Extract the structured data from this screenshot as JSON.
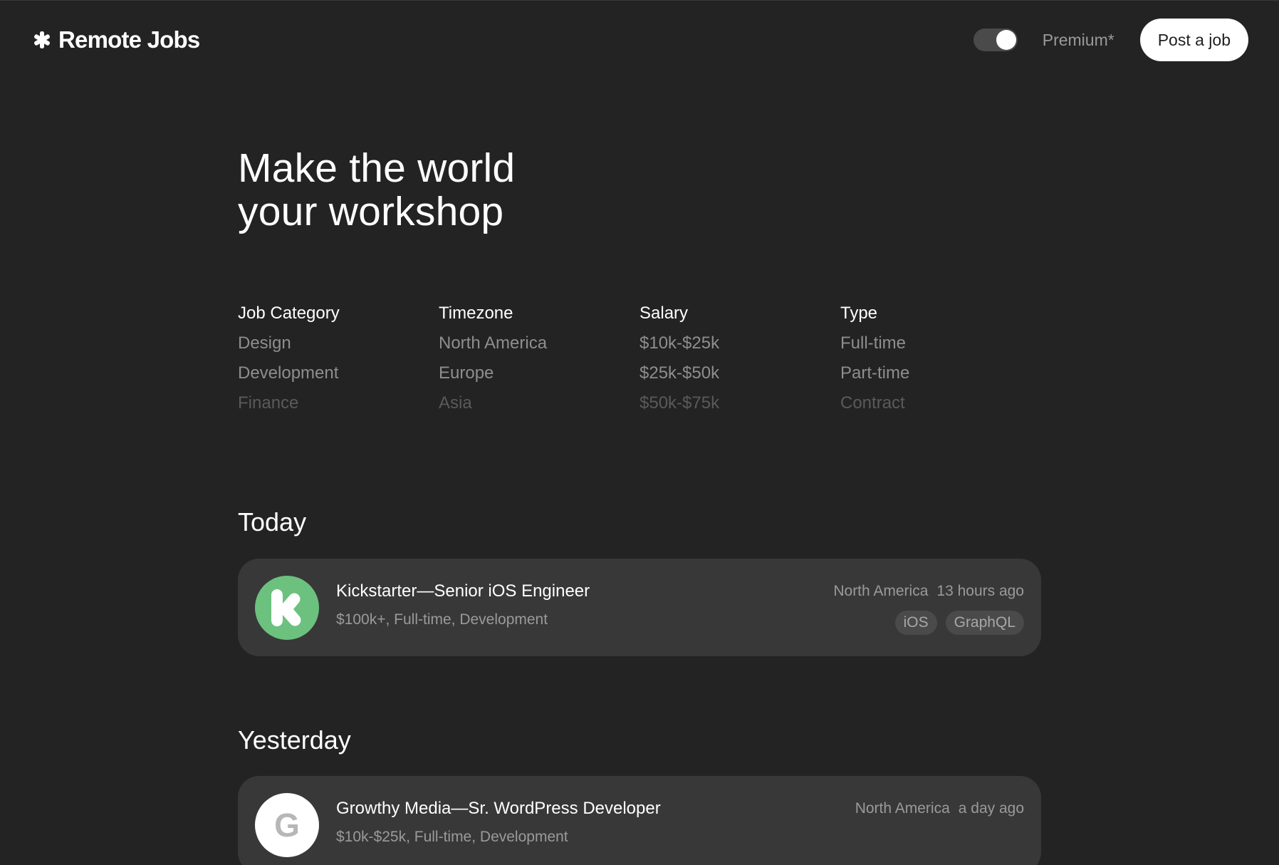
{
  "header": {
    "brand": "Remote Jobs",
    "premium_label": "Premium*",
    "post_job_label": "Post a job",
    "premium_toggle_on": true
  },
  "hero": {
    "title_line1": "Make the world",
    "title_line2": "your workshop"
  },
  "filters": [
    {
      "heading": "Job Category",
      "options": [
        "Design",
        "Development",
        "Finance"
      ]
    },
    {
      "heading": "Timezone",
      "options": [
        "North America",
        "Europe",
        "Asia"
      ]
    },
    {
      "heading": "Salary",
      "options": [
        "$10k-$25k",
        "$25k-$50k",
        "$50k-$75k"
      ]
    },
    {
      "heading": "Type",
      "options": [
        "Full-time",
        "Part-time",
        "Contract"
      ]
    }
  ],
  "sections": [
    {
      "title": "Today",
      "jobs": [
        {
          "company": "Kickstarter",
          "role": "Senior iOS Engineer",
          "meta": "$100k+, Full-time, Development",
          "region": "North America",
          "posted": "13 hours ago",
          "tags": [
            "iOS",
            "GraphQL"
          ],
          "logo_color": "#6cc17e"
        }
      ]
    },
    {
      "title": "Yesterday",
      "jobs": [
        {
          "company": "Growthy Media",
          "role": "Sr. WordPress Developer",
          "meta": "$10k-$25k, Full-time, Development",
          "region": "North America",
          "posted": "a day ago",
          "logo_letter": "G",
          "logo_color": "#ffffff"
        }
      ]
    }
  ],
  "colors": {
    "background": "#232323",
    "card": "#383838",
    "muted_text": "#9a9a9a",
    "kickstarter_green": "#6cc17e"
  },
  "icons": {
    "brand": "asterisk-icon",
    "kickstarter_logo": "kickstarter-k-icon"
  }
}
